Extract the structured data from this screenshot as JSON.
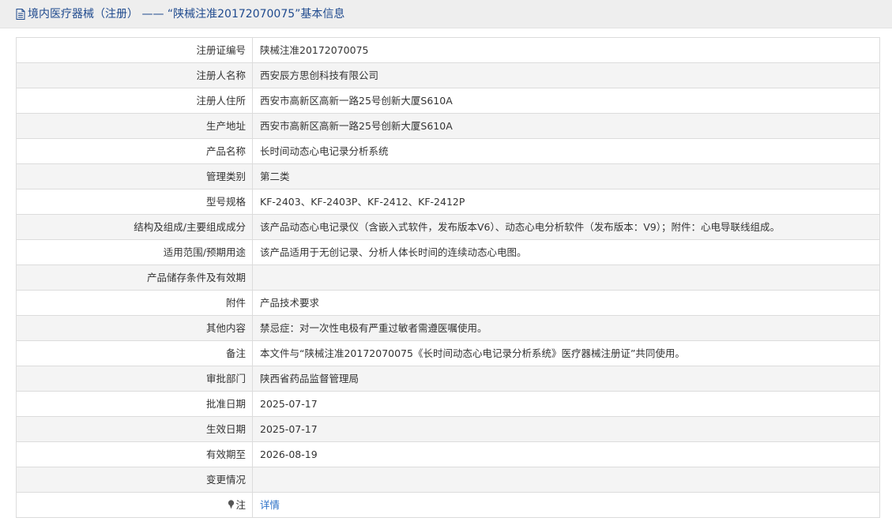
{
  "header": {
    "title": "境内医疗器械（注册） —— “陕械注准20172070075”基本信息"
  },
  "rows": [
    {
      "label": "注册证编号",
      "value": "陕械注准20172070075"
    },
    {
      "label": "注册人名称",
      "value": "西安辰方思创科技有限公司"
    },
    {
      "label": "注册人住所",
      "value": "西安市高新区高新一路25号创新大厦S610A"
    },
    {
      "label": "生产地址",
      "value": "西安市高新区高新一路25号创新大厦S610A"
    },
    {
      "label": "产品名称",
      "value": "长时间动态心电记录分析系统"
    },
    {
      "label": "管理类别",
      "value": "第二类"
    },
    {
      "label": "型号规格",
      "value": "KF-2403、KF-2403P、KF-2412、KF-2412P"
    },
    {
      "label": "结构及组成/主要组成成分",
      "value": "该产品动态心电记录仪（含嵌入式软件，发布版本V6）、动态心电分析软件（发布版本：V9）；附件：心电导联线组成。"
    },
    {
      "label": "适用范围/预期用途",
      "value": "该产品适用于无创记录、分析人体长时间的连续动态心电图。"
    },
    {
      "label": "产品储存条件及有效期",
      "value": ""
    },
    {
      "label": "附件",
      "value": "产品技术要求"
    },
    {
      "label": "其他内容",
      "value": "禁忌症：对一次性电极有严重过敏者需遵医嘱使用。"
    },
    {
      "label": "备注",
      "value": "本文件与“陕械注准20172070075《长时间动态心电记录分析系统》医疗器械注册证”共同使用。"
    },
    {
      "label": "审批部门",
      "value": "陕西省药品监督管理局"
    },
    {
      "label": "批准日期",
      "value": "2025-07-17"
    },
    {
      "label": "生效日期",
      "value": "2025-07-17"
    },
    {
      "label": "有效期至",
      "value": "2026-08-19"
    },
    {
      "label": "变更情况",
      "value": ""
    }
  ],
  "note_row": {
    "label": "注",
    "link_text": "详情",
    "icon": "pin-icon"
  },
  "colors": {
    "title": "#1f4a8e",
    "link": "#2a6fc7",
    "header_bg": "#eeeeee",
    "row_alt": "#f4f4f4"
  }
}
